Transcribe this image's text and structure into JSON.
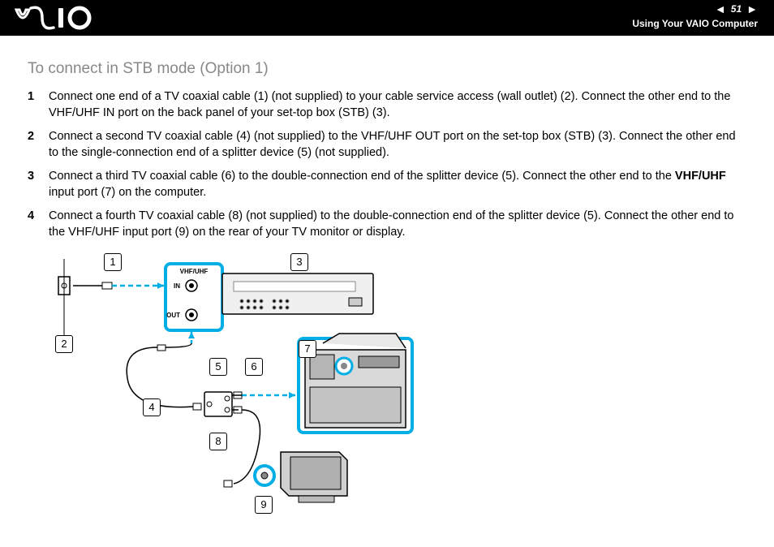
{
  "header": {
    "logo": "\\⁄AIΟ",
    "page_number": "51",
    "section": "Using Your VAIO Computer",
    "prev": "◄",
    "next": "►"
  },
  "title": "To connect in STB mode (Option 1)",
  "steps": [
    {
      "n": "1",
      "pre": "Connect one end of a TV coaxial cable (1) (not supplied) to your cable service access (wall outlet) (2). Connect the other end to the VHF/UHF IN port on the back panel of your set-top box (STB) (3).",
      "bold": "",
      "post": ""
    },
    {
      "n": "2",
      "pre": "Connect a second TV coaxial cable (4) (not supplied) to the VHF/UHF OUT port on the set-top box (STB) (3). Connect the other end to the single-connection end of a splitter device (5) (not supplied).",
      "bold": "",
      "post": ""
    },
    {
      "n": "3",
      "pre": "Connect a third TV coaxial cable (6) to the double-connection end of the splitter device (5). Connect the other end to the ",
      "bold": "VHF/UHF",
      "post": " input port (7) on the computer."
    },
    {
      "n": "4",
      "pre": "Connect a fourth TV coaxial cable (8) (not supplied) to the double-connection end of the splitter device (5). Connect the other end to the VHF/UHF input port (9) on the rear of your TV monitor or display.",
      "bold": "",
      "post": ""
    }
  ],
  "callouts": {
    "c1": "1",
    "c2": "2",
    "c3": "3",
    "c4": "4",
    "c5": "5",
    "c6": "6",
    "c7": "7",
    "c8": "8",
    "c9": "9"
  },
  "labels": {
    "vhfuhf": "VHF/UHF",
    "in": "IN",
    "out": "OUT"
  }
}
